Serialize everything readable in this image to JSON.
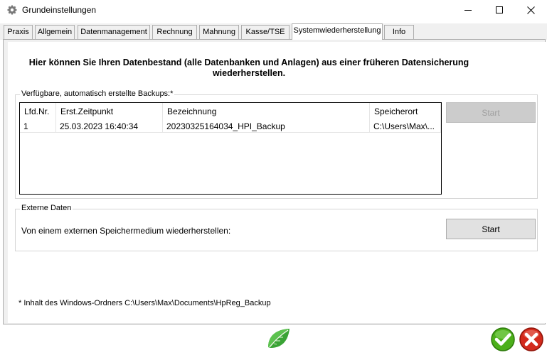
{
  "window": {
    "title": "Grundeinstellungen",
    "icons": {
      "app": "gear-icon",
      "minimize": "minimize-icon",
      "maximize": "maximize-icon",
      "close": "close-icon"
    }
  },
  "tabs": [
    {
      "label": "Praxis"
    },
    {
      "label": "Allgemein"
    },
    {
      "label": "Datenmanagement"
    },
    {
      "label": "Rechnung"
    },
    {
      "label": "Mahnung"
    },
    {
      "label": "Kasse/TSE"
    },
    {
      "label": "Systemwiederherstellung",
      "active": true
    },
    {
      "label": "Info"
    }
  ],
  "main": {
    "heading_line1": "Hier können Sie Ihren Datenbestand (alle Datenbanken und Anlagen) aus einer früheren Datensicherung",
    "heading_line2": "wiederherstellen.",
    "backups_group": {
      "legend": "Verfügbare, automatisch erstellte Backups:*",
      "columns": [
        "Lfd.Nr.",
        "Erst.Zeitpunkt",
        "Bezeichnung",
        "Speicherort"
      ],
      "rows": [
        [
          "1",
          "25.03.2023 16:40:34",
          "20230325164034_HPI_Backup",
          "C:\\Users\\Max\\..."
        ]
      ],
      "start_label": "Start",
      "start_enabled": false
    },
    "external_group": {
      "legend": "Externe Daten",
      "label": "Von einem externen Speichermedium wiederherstellen:",
      "start_label": "Start"
    },
    "footnote": "* Inhalt des Windows-Ordners C:\\Users\\Max\\Documents\\HpReg_Backup"
  },
  "footer": {
    "icons": {
      "logo": "leaf-icon",
      "ok": "ok-check-icon",
      "cancel": "cancel-x-icon"
    },
    "colors": {
      "ok": "#4caf1a",
      "cancel": "#d32a1c",
      "leaf": "#3aa335"
    }
  }
}
